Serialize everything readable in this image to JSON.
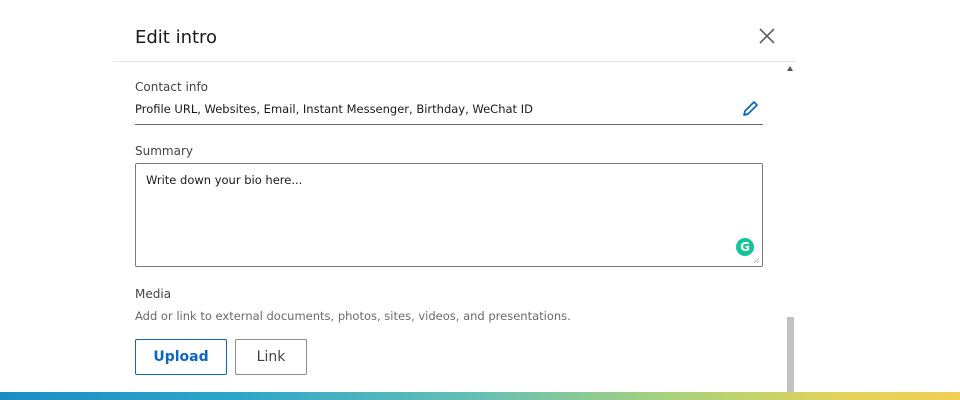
{
  "modal": {
    "title": "Edit intro",
    "close_icon": "close-icon"
  },
  "contact": {
    "label": "Contact info",
    "value": "Profile URL, Websites, Email, Instant Messenger, Birthday, WeChat ID",
    "edit_icon": "pencil-icon"
  },
  "summary": {
    "label": "Summary",
    "value": "Write down your bio here...",
    "grammarly_icon": "grammarly-icon",
    "grammarly_letter": "G"
  },
  "media": {
    "label": "Media",
    "description": "Add or link to external documents, photos, sites, videos, and presentations.",
    "upload_label": "Upload",
    "link_label": "Link"
  },
  "colors": {
    "accent": "#0a66c2",
    "grammarly": "#15c39a",
    "gradient": [
      "#1a8dc4",
      "#66c0b3",
      "#a8d27a",
      "#f0cf52"
    ]
  }
}
